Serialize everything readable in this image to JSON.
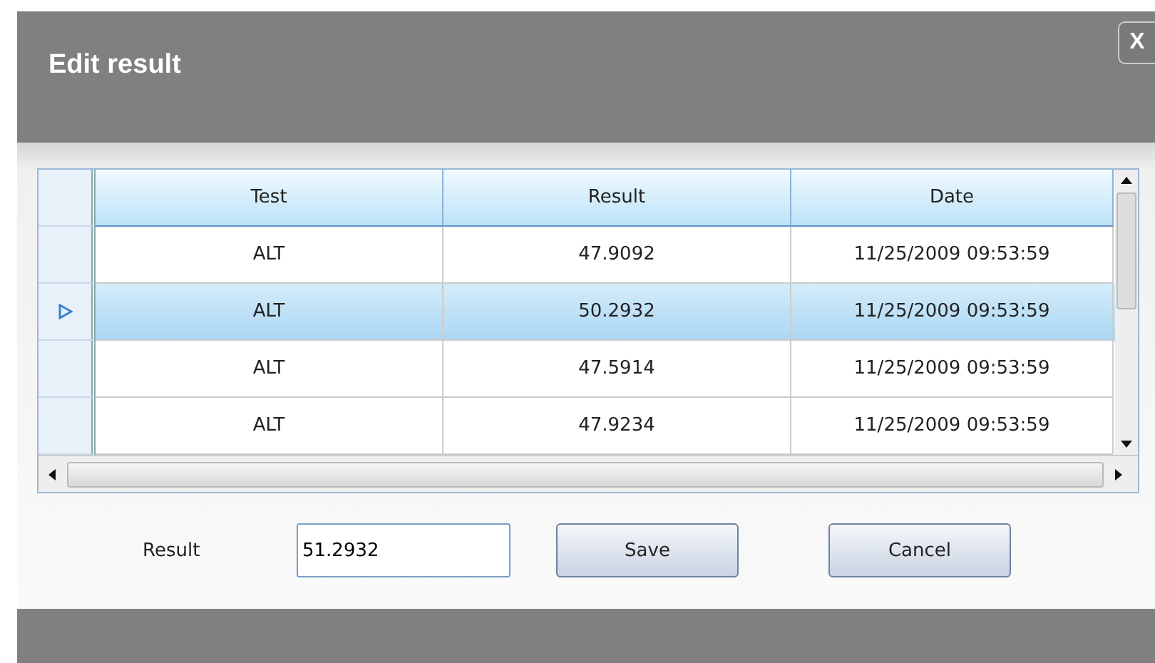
{
  "dialog": {
    "title": "Edit result",
    "close_label": "X"
  },
  "table": {
    "columns": [
      "Test",
      "Result",
      "Date"
    ],
    "rows": [
      {
        "cells": [
          "ALT",
          "47.9092",
          "11/25/2009 09:53:59"
        ],
        "selected": false
      },
      {
        "cells": [
          "ALT",
          "50.2932",
          "11/25/2009 09:53:59"
        ],
        "selected": true
      },
      {
        "cells": [
          "ALT",
          "47.5914",
          "11/25/2009 09:53:59"
        ],
        "selected": false
      },
      {
        "cells": [
          "ALT",
          "47.9234",
          "11/25/2009 09:53:59"
        ],
        "selected": false
      }
    ]
  },
  "form": {
    "label": "Result",
    "value": "51.2932",
    "buttons": [
      "Save",
      "Cancel"
    ]
  }
}
